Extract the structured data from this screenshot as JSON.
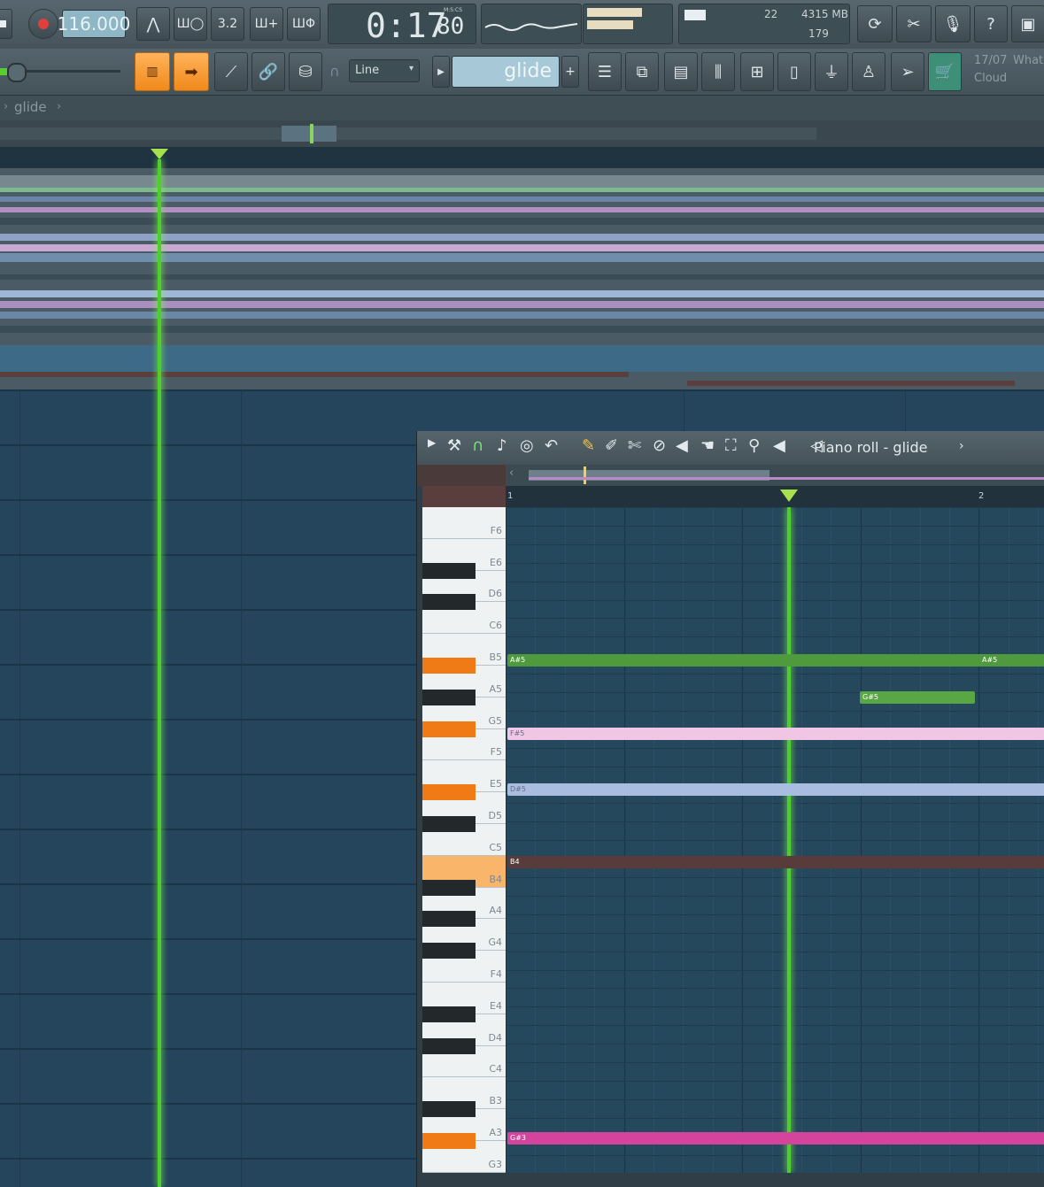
{
  "toolbar": {
    "tempo": "116.000",
    "time_main": "0:17",
    "time_sub": "80",
    "time_units": "M:S:CS",
    "cpu_value": "22",
    "memory": "4315 MB",
    "polyphony": "179",
    "snap_mode": "Line",
    "pattern_name": "glide",
    "news_date": "17/07",
    "news_text": "What",
    "news_sub": "Cloud",
    "pattern_buttons": [
      "3.2",
      "?"
    ]
  },
  "playlist": {
    "breadcrumb": "glide",
    "playhead_fraction": 0.15
  },
  "piano_roll": {
    "title": "Piano roll - glide",
    "ruler_marks": [
      "1",
      "2"
    ],
    "key_labels": [
      "F6",
      "E6",
      "D6",
      "C6",
      "B5",
      "A5",
      "G5",
      "F5",
      "E5",
      "D5",
      "C5",
      "B4",
      "A4",
      "G4",
      "F4",
      "E4",
      "D4",
      "C4",
      "B3",
      "A3",
      "G3"
    ],
    "notes": [
      {
        "label": "A#5",
        "label_end": "A#5",
        "color": "#4e9a3c"
      },
      {
        "label": "G#5",
        "color": "#58a644"
      },
      {
        "label": "F#5",
        "color": "#f0c6e4"
      },
      {
        "label": "D#5",
        "color": "#a9bde0"
      },
      {
        "label": "B4",
        "color": "#5a3b3b"
      },
      {
        "label": "G#3",
        "color": "#d4449c"
      }
    ]
  }
}
